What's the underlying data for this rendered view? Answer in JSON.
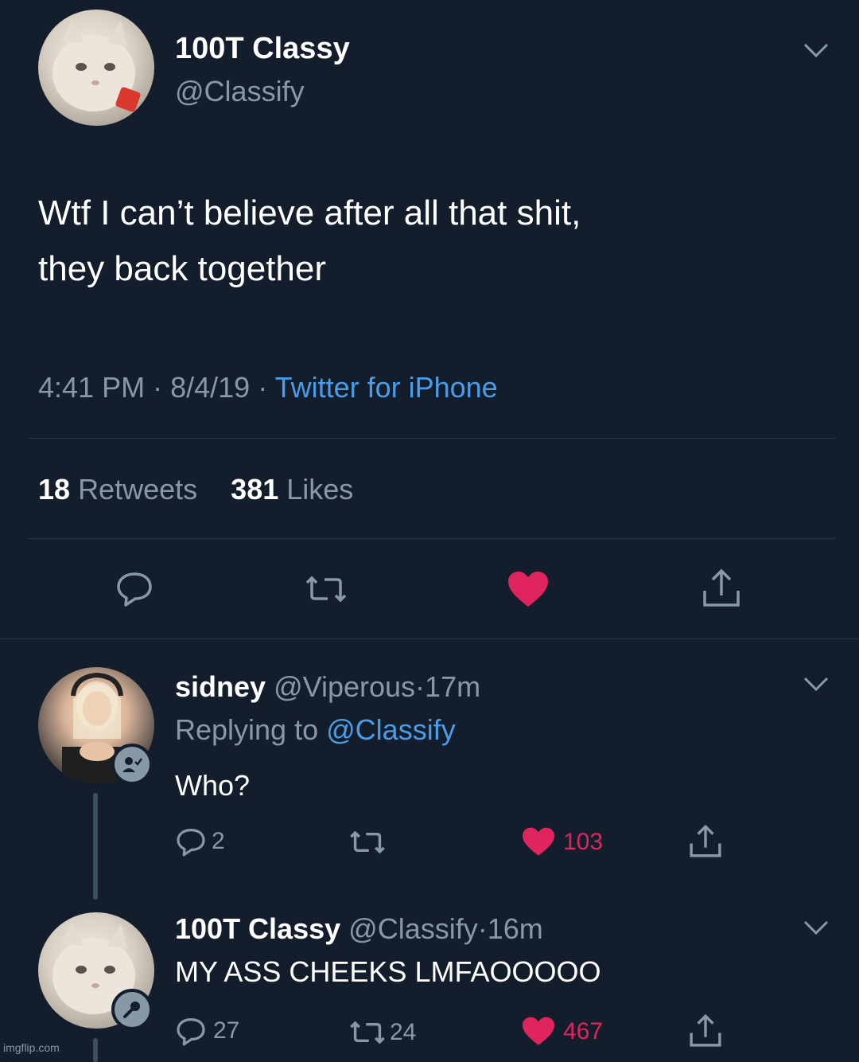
{
  "main_tweet": {
    "display_name": "100T Classy",
    "handle": "@Classify",
    "text_line1": "Wtf I can’t believe after all that shit,",
    "text_line2": "they back together",
    "time": "4:41 PM",
    "date": "8/4/19",
    "source": "Twitter for iPhone",
    "retweets_count": "18",
    "retweets_label": "Retweets",
    "likes_count": "381",
    "likes_label": "Likes"
  },
  "replies": [
    {
      "display_name": "sidney",
      "handle": "@Viperous",
      "time": "17m",
      "replying_prefix": "Replying to",
      "replying_to": "@Classify",
      "text": "Who?",
      "reply_count": "2",
      "retweet_count": "",
      "like_count": "103"
    },
    {
      "display_name": "100T Classy",
      "handle": "@Classify",
      "time": "16m",
      "text": "MY ASS CHEEKS LMFAOOOOO",
      "reply_count": "27",
      "retweet_count": "24",
      "like_count": "467"
    }
  ],
  "separator": "·",
  "watermark": "imgflip.com",
  "colors": {
    "background": "#141d2b",
    "text": "#ffffff",
    "secondary": "#8899a6",
    "link": "#4a9de6",
    "like": "#e0245e"
  },
  "icons": [
    "chevron-down-icon",
    "reply-icon",
    "retweet-icon",
    "heart-icon",
    "share-icon",
    "badge-icon",
    "microphone-icon"
  ]
}
